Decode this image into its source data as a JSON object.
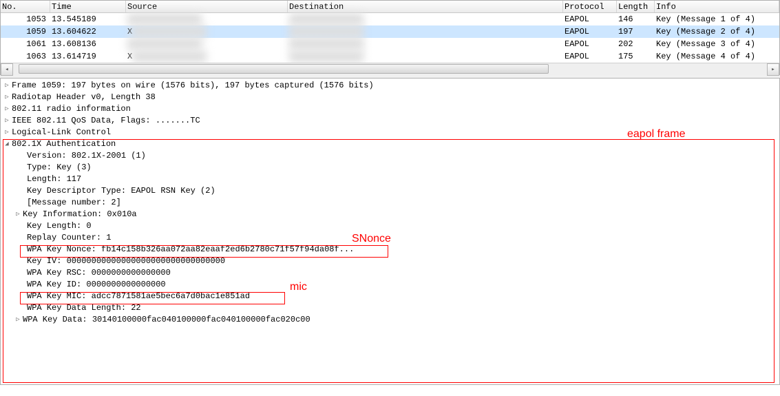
{
  "columns": {
    "no": "No.",
    "time": "Time",
    "source": "Source",
    "destination": "Destination",
    "protocol": "Protocol",
    "length": "Length",
    "info": "Info"
  },
  "packets": [
    {
      "no": "1053",
      "time": "13.545189",
      "src": "",
      "dst": "",
      "proto": "EAPOL",
      "len": "146",
      "info": "Key (Message 1 of 4)",
      "sel": false
    },
    {
      "no": "1059",
      "time": "13.604622",
      "src": "X",
      "dst": "",
      "proto": "EAPOL",
      "len": "197",
      "info": "Key (Message 2 of 4)",
      "sel": true
    },
    {
      "no": "1061",
      "time": "13.608136",
      "src": "",
      "dst": "",
      "proto": "EAPOL",
      "len": "202",
      "info": "Key (Message 3 of 4)",
      "sel": false
    },
    {
      "no": "1063",
      "time": "13.614719",
      "src": "X",
      "dst": "",
      "proto": "EAPOL",
      "len": "175",
      "info": "Key (Message 4 of 4)",
      "sel": false
    }
  ],
  "tree": {
    "t0": "Frame 1059: 197 bytes on wire (1576 bits), 197 bytes captured (1576 bits)",
    "t1": "Radiotap Header v0, Length 38",
    "t2": "802.11 radio information",
    "t3": "IEEE 802.11 QoS Data, Flags: .......TC",
    "t4": "Logical-Link Control",
    "t5": "802.1X Authentication",
    "d0": "Version: 802.1X-2001 (1)",
    "d1": "Type: Key (3)",
    "d2": "Length: 117",
    "d3": "Key Descriptor Type: EAPOL RSN Key (2)",
    "d4": "[Message number: 2]",
    "d5": "Key Information: 0x010a",
    "d6": "Key Length: 0",
    "d7": "Replay Counter: 1",
    "d8": "WPA Key Nonce: fb14c158b326aa072aa82eaaf2ed6b2780c71f57f94da08f...",
    "d9": "Key IV: 00000000000000000000000000000000",
    "d10": "WPA Key RSC: 0000000000000000",
    "d11": "WPA Key ID: 0000000000000000",
    "d12": "WPA Key MIC: adcc7871581ae5bec6a7d0bac1e851ad",
    "d13": "WPA Key Data Length: 22",
    "d14": "WPA Key Data: 30140100000fac040100000fac040100000fac020c00"
  },
  "annotations": {
    "eapol": "eapol frame",
    "snonce": "SNonce",
    "mic": "mic"
  }
}
